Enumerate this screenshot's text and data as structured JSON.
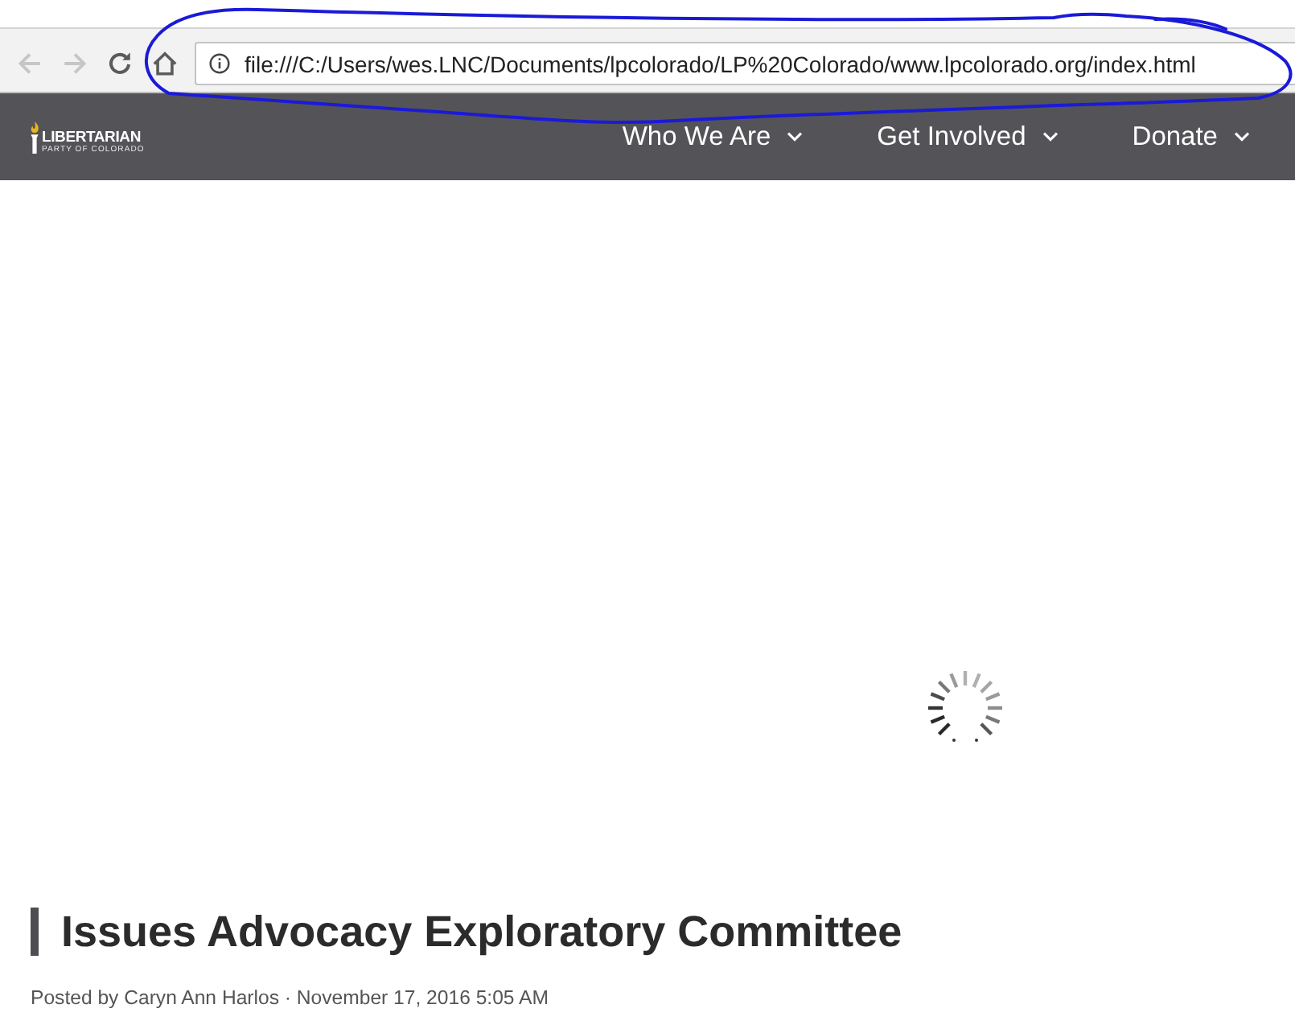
{
  "browser": {
    "toolbar_buttons": [
      {
        "kind": "back",
        "disabled": true
      },
      {
        "kind": "forward",
        "disabled": true
      },
      {
        "kind": "reload",
        "disabled": false
      },
      {
        "kind": "home",
        "disabled": false
      }
    ],
    "address_bar": {
      "value": "file:///C:/Users/wes.LNC/Documents/lpcolorado/LP%20Colorado/www.lpcolorado.org/index.html"
    }
  },
  "site_header": {
    "logo": {
      "name": "LIBERTARIAN",
      "tagline": "PARTY OF COLORADO"
    },
    "nav": [
      {
        "label": "Who We Are"
      },
      {
        "label": "Get Involved"
      },
      {
        "label": "Donate"
      }
    ]
  },
  "post": {
    "title": "Issues Advocacy Exploratory Committee",
    "byline": "Posted by Caryn Ann Harlos · November 17, 2016 5:05 AM"
  }
}
